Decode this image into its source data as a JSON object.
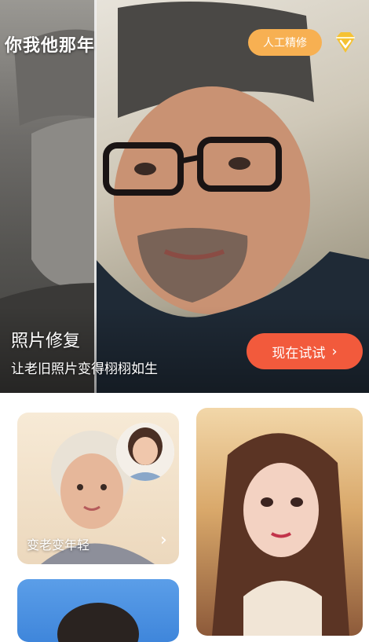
{
  "app": {
    "title": "你我他那年"
  },
  "header": {
    "manual_label": "人工精修",
    "vip_icon": "diamond-icon"
  },
  "hero": {
    "title": "照片修复",
    "subtitle": "让老旧照片变得栩栩如生",
    "cta_label": "现在试试",
    "cta_chevron": "›"
  },
  "cards": {
    "age": {
      "label": "变老变年轻",
      "chevron": "›"
    }
  },
  "colors": {
    "accent": "#f25a3c",
    "vip": "#f7b052",
    "diamond": "#f5c233"
  }
}
